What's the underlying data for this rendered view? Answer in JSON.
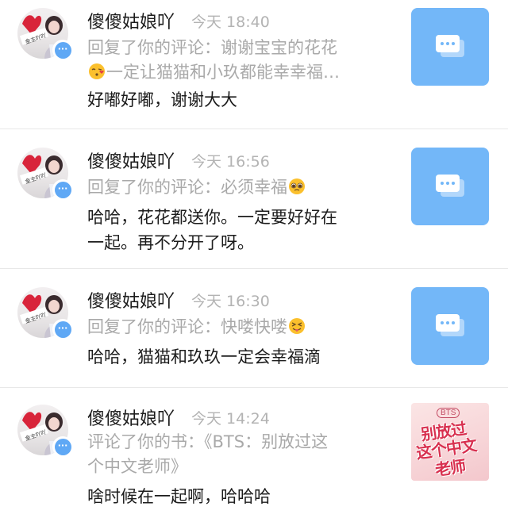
{
  "colors": {
    "accent": "#73b7f8",
    "badge": "#5fa8f5",
    "muted": "#a9a9a9",
    "text": "#1c1c1c"
  },
  "notifications": [
    {
      "name": "傻傻姑娘吖",
      "time": "今天 18:40",
      "reply_a": "回复了你的评论：谢谢宝宝的花花",
      "reply_b": "一定让猫猫和小玖都能幸幸福…",
      "emoji": "kissing-face-emoji",
      "body": "好嘟好嘟，谢谢大大",
      "thumb": "comment-thumbnail"
    },
    {
      "name": "傻傻姑娘吖",
      "time": "今天 16:56",
      "reply_a": "回复了你的评论：必须幸福",
      "emoji": "pleading-face-emoji",
      "body_1": "哈哈，花花都送你。一定要好好在",
      "body_2": "一起。再不分开了呀。",
      "thumb": "comment-thumbnail"
    },
    {
      "name": "傻傻姑娘吖",
      "time": "今天 16:30",
      "reply_a": "回复了你的评论：快喽快喽",
      "emoji": "squinting-tongue-emoji",
      "body": "哈哈，猫猫和玖玖一定会幸福滴",
      "thumb": "comment-thumbnail"
    },
    {
      "name": "傻傻姑娘吖",
      "time": "今天 14:24",
      "reply_a": "评论了你的书：《BTS：别放过这",
      "reply_b": "个中文老师》",
      "body": "啥时候在一起啊，哈哈哈",
      "book_tag": "BTS",
      "book_line1": "别放过",
      "book_line2": "这个中文",
      "book_line3": "老师"
    }
  ]
}
